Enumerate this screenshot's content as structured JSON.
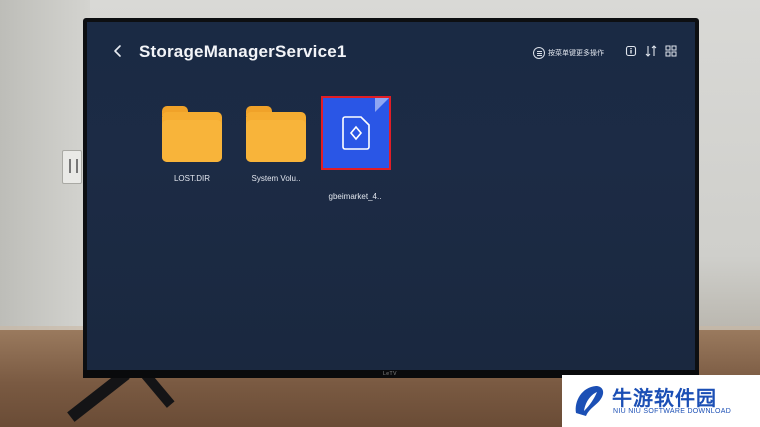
{
  "header": {
    "title": "StorageManagerService1",
    "menu_hint": "按菜单键更多操作"
  },
  "files": [
    {
      "name": "LOST.DIR",
      "type": "folder",
      "selected": false
    },
    {
      "name": "System Volu..",
      "type": "folder",
      "selected": false
    },
    {
      "name": "gbeimarket_4..",
      "type": "apk",
      "selected": true
    }
  ],
  "tv": {
    "brand": "LeTV"
  },
  "watermark": {
    "name_cn": "牛游软件园",
    "name_en": "NIU NIU SOFTWARE DOWNLOAD"
  },
  "colors": {
    "screen_bg": "#1c2b45",
    "folder": "#f5ac31",
    "selection_fill": "#2a56e6",
    "selection_border": "#e21d25",
    "watermark_blue": "#1b4fb5"
  },
  "icons": [
    "back-arrow-icon",
    "menu-icon",
    "info-icon",
    "sort-icon",
    "grid-view-icon",
    "folder-icon",
    "apk-file-icon"
  ]
}
